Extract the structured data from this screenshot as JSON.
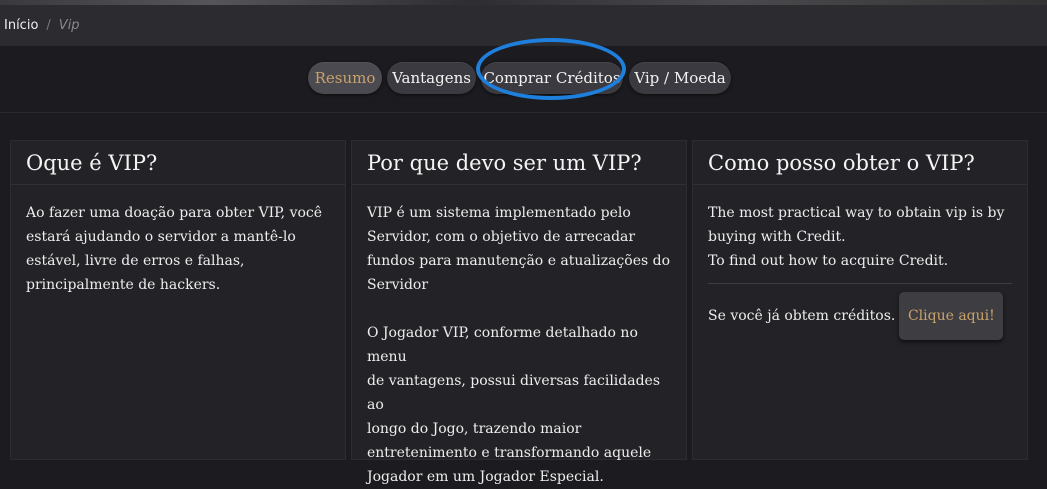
{
  "breadcrumb": {
    "home": "Início",
    "separator": "/",
    "current": "Vip"
  },
  "tabs": [
    {
      "label": "Resumo"
    },
    {
      "label": "Vantagens"
    },
    {
      "label": "Comprar Créditos"
    },
    {
      "label": "Vip / Moeda"
    }
  ],
  "cards": [
    {
      "title": "Oque é VIP?",
      "lines": [
        "Ao fazer uma doação para obter VIP, você",
        "estará ajudando o servidor a mantê-lo",
        "estável, livre de erros e falhas,",
        "principalmente de hackers."
      ]
    },
    {
      "title": "Por que devo ser um VIP?",
      "lines_a": [
        "VIP é um sistema implementado pelo",
        "Servidor, com o objetivo de arrecadar",
        "fundos para manutenção e atualizações do",
        "Servidor"
      ],
      "lines_b": [
        "O Jogador VIP, conforme detalhado no menu",
        "de vantagens, possui diversas facilidades ao",
        "longo do Jogo, trazendo maior",
        "entretenimento e transformando aquele",
        "Jogador em um Jogador Especial."
      ]
    },
    {
      "title": "Como posso obter o VIP?",
      "lines": [
        "The most practical way to obtain vip is by",
        "buying with Credit.",
        "To find out how to acquire Credit."
      ],
      "credits_text": "Se você já obtem créditos.",
      "button": "Clique aqui!"
    }
  ],
  "colors": {
    "accent": "#c9a26b",
    "highlight_circle": "#1f7fdc"
  }
}
